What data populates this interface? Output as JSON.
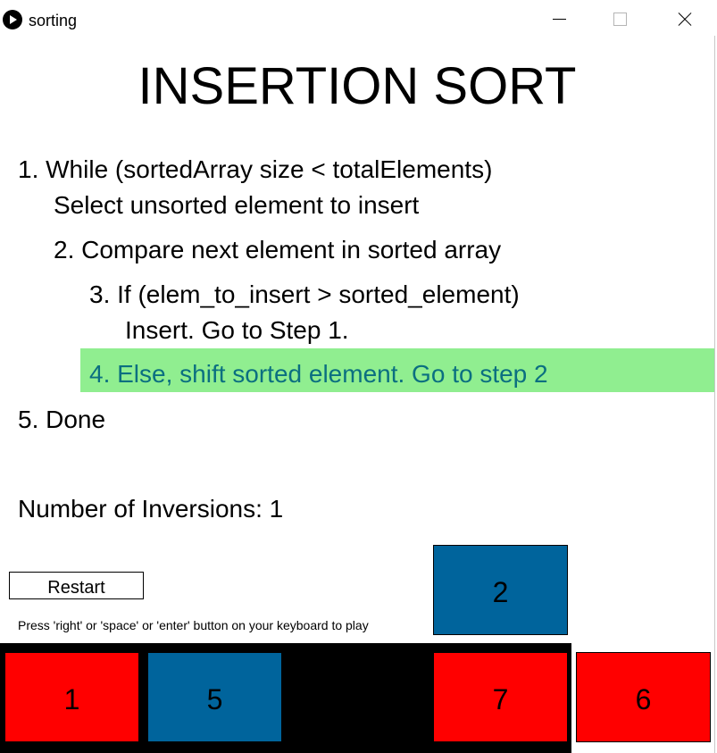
{
  "window": {
    "title": "sorting"
  },
  "heading": "INSERTION SORT",
  "steps": {
    "step1_line1": "1. While (sortedArray size < totalElements)",
    "step1_line2": "Select unsorted element to insert",
    "step2": "2. Compare next element in sorted array",
    "step3_line1": "3. If (elem_to_insert > sorted_element)",
    "step3_line2": "Insert. Go to Step 1.",
    "step4": "4. Else, shift sorted element. Go to step 2",
    "step5": "5. Done"
  },
  "active_step": 4,
  "inversions_text": "Number of Inversions: 1",
  "controls": {
    "restart_label": "Restart",
    "hint": "Press 'right' or 'space' or 'enter' button on your keyboard to play"
  },
  "element_to_insert": {
    "value": "2",
    "color": "#00649c"
  },
  "array_blocks": [
    {
      "value": "1",
      "color": "#ff0000"
    },
    {
      "value": "5",
      "color": "#00649c"
    },
    {
      "value": "",
      "color": "#000000"
    },
    {
      "value": "7",
      "color": "#ff0000"
    },
    {
      "value": "6",
      "color": "#ff0000"
    }
  ],
  "colors": {
    "highlight": "#90ee90",
    "active_step_text": "#0b6f80",
    "sorted": "#ff0000",
    "unsorted": "#00649c"
  }
}
